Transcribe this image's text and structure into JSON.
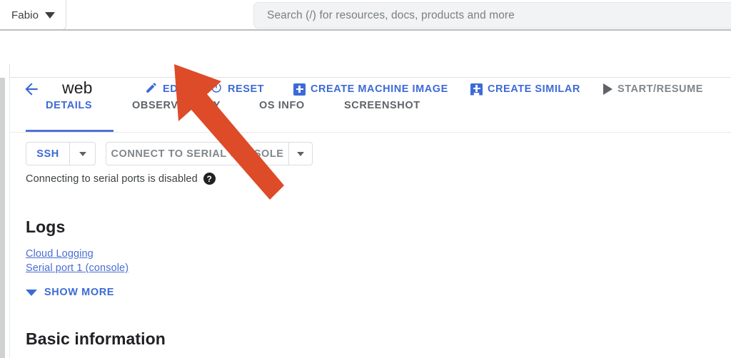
{
  "topbar": {
    "account_label": "Fabio",
    "account_caret_icon": "caret-down-icon",
    "search_placeholder": "Search (/) for resources, docs, products and more",
    "search_value": ""
  },
  "actionbar": {
    "back_icon": "arrow-left-icon",
    "title": "web",
    "actions": [
      {
        "label": "EDIT",
        "icon": "pencil-icon",
        "enabled": true
      },
      {
        "label": "RESET",
        "icon": "power-icon",
        "enabled": true
      },
      {
        "label": "CREATE MACHINE IMAGE",
        "icon": "plus-square-icon",
        "enabled": true
      },
      {
        "label": "CREATE SIMILAR",
        "icon": "plus-tag-icon",
        "enabled": true
      },
      {
        "label": "START/RESUME",
        "icon": "play-icon",
        "enabled": false
      }
    ]
  },
  "tabs": {
    "items": [
      {
        "label": "DETAILS",
        "active": true
      },
      {
        "label": "OBSERVABILITY",
        "active": false
      },
      {
        "label": "OS INFO",
        "active": false
      },
      {
        "label": "SCREENSHOT",
        "active": false
      }
    ]
  },
  "connect": {
    "ssh_label": "SSH",
    "ssh_caret_icon": "caret-down-icon",
    "serial_label": "CONNECT TO SERIAL CONSOLE",
    "serial_caret_icon": "caret-down-icon",
    "note_text": "Connecting to serial ports is disabled",
    "note_help_icon": "help-circle-icon",
    "note_help_glyph": "?"
  },
  "logs": {
    "heading": "Logs",
    "links": [
      "Cloud Logging",
      "Serial port 1 (console)"
    ],
    "show_more_label": "SHOW MORE",
    "show_more_icon": "chevron-down-icon"
  },
  "basic_information": {
    "heading": "Basic information"
  },
  "annotation": {
    "type": "arrow",
    "name": "red-arrow-annotation",
    "color": "#dd4b28",
    "points_to": "EDIT"
  },
  "colors": {
    "accent_blue": "#3d6ad6",
    "link_blue": "#4a6fd4",
    "text_primary": "#202124",
    "text_secondary": "#5f6368",
    "disabled_gray": "#80868b",
    "search_bg": "#f1f3f4",
    "annotation_red": "#dd4b28"
  }
}
